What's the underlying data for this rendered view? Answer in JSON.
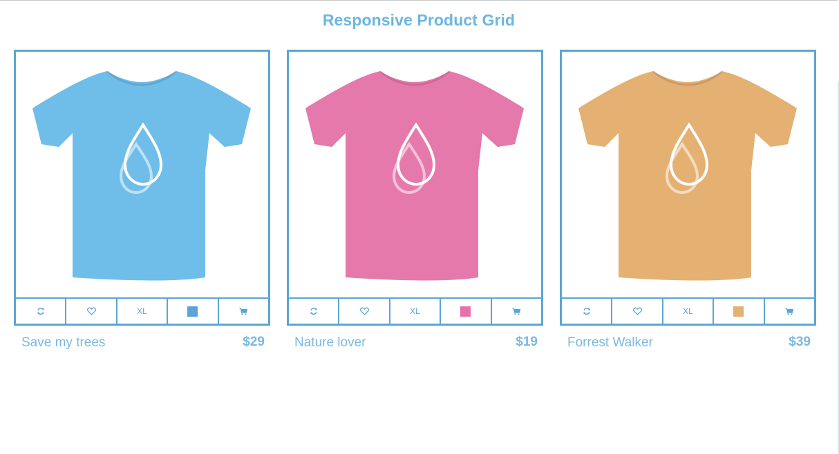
{
  "page": {
    "title": "Responsive Product Grid"
  },
  "colors": {
    "accent": "#5aa5d6",
    "title": "#6cb6e3",
    "text": "#79b9e2"
  },
  "toolbar_icons": [
    "refresh-icon",
    "heart-icon",
    "size-label",
    "color-swatch",
    "cart-icon"
  ],
  "products": [
    {
      "name": "Save my trees",
      "price": "$29",
      "size": "XL",
      "color": "#6fbde9",
      "swatch": "#5aa5d6"
    },
    {
      "name": "Nature lover",
      "price": "$19",
      "size": "XL",
      "color": "#e579ab",
      "swatch": "#e86fab"
    },
    {
      "name": "Forrest Walker",
      "price": "$39",
      "size": "XL",
      "color": "#e4b173",
      "swatch": "#e4b173"
    }
  ]
}
